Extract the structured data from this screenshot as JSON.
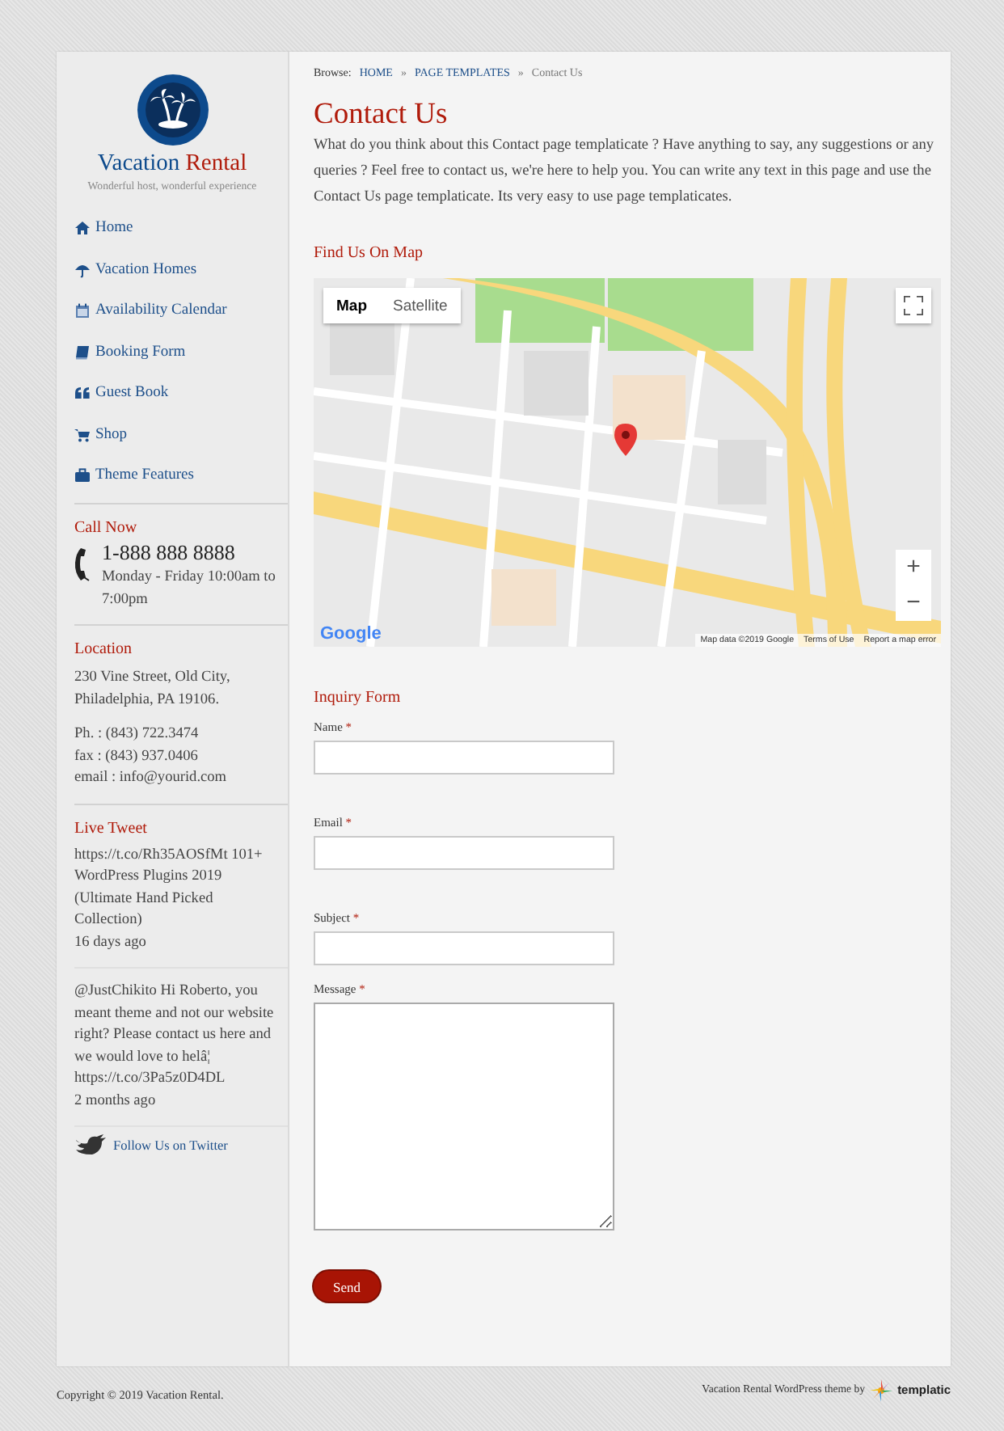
{
  "site": {
    "title_part_1": "Vacation",
    "title_part_2": "Rental",
    "tagline": "Wonderful host, wonderful experience"
  },
  "nav": [
    {
      "label": "Home"
    },
    {
      "label": "Vacation Homes"
    },
    {
      "label": "Availability Calendar"
    },
    {
      "label": "Booking Form"
    },
    {
      "label": "Guest Book"
    },
    {
      "label": "Shop"
    },
    {
      "label": "Theme Features"
    }
  ],
  "call_now": {
    "heading": "Call Now",
    "phone": "1-888 888 8888",
    "hours": "Monday - Friday 10:00am to 7:00pm"
  },
  "location": {
    "heading": "Location",
    "address": [
      "230 Vine Street, Old City,",
      "Philadelphia, PA 19106."
    ],
    "contacts": [
      "Ph. : (843) 722.3474",
      "fax : (843) 937.0406",
      "email : info@yourid.com"
    ]
  },
  "live_tweet": {
    "heading": "Live Tweet",
    "tweets": [
      {
        "text": "https://t.co/Rh35AOSfMt 101+ WordPress Plugins 2019 (Ultimate Hand Picked Collection)",
        "time": "16 days ago"
      },
      {
        "text": "@JustChikito Hi Roberto, you meant theme and not our website right? Please contact us here and we would love to helâ¦ https://t.co/3Pa5z0D4DL",
        "time": "2 months ago"
      }
    ],
    "follow": "Follow Us on Twitter"
  },
  "breadcrumb": {
    "label": "Browse:",
    "items": [
      "HOME",
      "PAGE TEMPLATES"
    ],
    "separators": [
      "»",
      "»"
    ],
    "current": "Contact Us"
  },
  "page_title": "Contact Us",
  "intro": "What do you think about this Contact page templaticate ? Have anything to say, any suggestions or any queries ? Feel free to contact us, we're here to help you. You can write any text in this page and use the Contact Us page templaticate. Its very easy to use page templaticates.",
  "map_section": {
    "heading": "Find Us On Map",
    "map_types": [
      {
        "label": "Map",
        "selected": true
      },
      {
        "label": "Satellite",
        "selected": false
      }
    ],
    "zoom_in": "+",
    "zoom_out": "−",
    "logo": "Google",
    "attribution": "Map data ©2019 Google",
    "terms": "Terms of Use",
    "report": "Report a map error"
  },
  "form": {
    "heading": "Inquiry Form",
    "fields": [
      {
        "label": "Name",
        "required_mark": "*",
        "kind": "input"
      },
      {
        "label": "Email",
        "required_mark": "*",
        "kind": "input"
      },
      {
        "label": "Subject",
        "required_mark": "*",
        "kind": "input"
      },
      {
        "label": "Message",
        "required_mark": "*",
        "kind": "textarea"
      }
    ],
    "submit": "Send"
  },
  "footer": {
    "copyright": "Copyright © 2019 Vacation Rental.",
    "credit": "Vacation Rental WordPress theme by",
    "brand": "templatic"
  }
}
